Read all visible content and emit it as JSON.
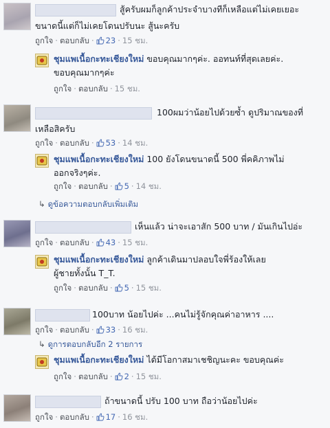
{
  "comments": [
    {
      "text_line1": "สู้ครับผมก็ลูกค้าประจำบางทีก็เหลือแต่ไม่เคยเยอะ",
      "text_line2": "ขนาดนี้แต่ก็ไม่เคยโดนปรับนะ สู้นะครับ",
      "like_label": "ถูกใจ",
      "reply_label": "ตอบกลับ",
      "likes": "23",
      "time": "15 ชม.",
      "reply": {
        "page_name": "ชุมแพเนื้อกะทะเชียงใหม่",
        "text_line1": "ขอบคุณมากๆค่ะ. ออทนท์ที่สุดเลยค่ะ.",
        "text_line2": "ขอบคุณมากๆค่ะ",
        "like_label": "ถูกใจ",
        "reply_label": "ตอบกลับ",
        "time": "15 ชม."
      }
    },
    {
      "text_line1": "100ผมว่าน้อยไปด้วยซ้ำ ดูปริมาณของที่",
      "text_line2": "เหลือสิครับ",
      "like_label": "ถูกใจ",
      "reply_label": "ตอบกลับ",
      "likes": "53",
      "time": "14 ชม.",
      "reply": {
        "page_name": "ชุมแพเนื้อกะทะเชียงใหม่",
        "text_line1": "100 ยังโดนขนาดนี้ 500 พี่คคิภาพไม่",
        "text_line2": "ออกจริงๆค่ะ.",
        "like_label": "ถูกใจ",
        "reply_label": "ตอบกลับ",
        "likes": "5",
        "time": "14 ชม."
      },
      "more_replies": "ดูข้อความตอบกลับเพิ่มเติม"
    },
    {
      "text_line1": "เห็นแล้ว น่าจะเอาสัก 500 บาท / มันเกินไปอ่ะ",
      "like_label": "ถูกใจ",
      "reply_label": "ตอบกลับ",
      "likes": "43",
      "time": "15 ชม.",
      "reply": {
        "page_name": "ชุมแพเนื้อกะทะเชียงใหม่",
        "text_line1": "ลูกค้าเดินมาปลอบใจพี่ร้องให้เลย",
        "text_line2": "ผู้ชายทั้งนั้น T_T.",
        "like_label": "ถูกใจ",
        "reply_label": "ตอบกลับ",
        "likes": "5",
        "time": "15 ชม."
      }
    },
    {
      "text_line1": "100บาท น้อยไปค่ะ ...คนไม่รู้จักคุณค่าอาหาร ....",
      "like_label": "ถูกใจ",
      "reply_label": "ตอบกลับ",
      "likes": "33",
      "time": "16 ชม.",
      "more_replies": "ดูการตอบกลับอีก 2 รายการ",
      "reply": {
        "page_name": "ชุมแพเนื้อกะทะเชียงใหม่",
        "text_line1": "ได้มีโอกาสมาเชชิญนะคะ ขอบคุณค่ะ",
        "like_label": "ถูกใจ",
        "reply_label": "ตอบกลับ",
        "likes": "2",
        "time": "15 ชม."
      }
    },
    {
      "text_line1": "ถ้าขนาดนี้ ปรับ 100 บาท ถือว่าน้อยไปค่ะ",
      "like_label": "ถูกใจ",
      "reply_label": "ตอบกลับ",
      "likes": "17",
      "time": "16 ชม."
    }
  ],
  "colors": {
    "link": "#365899",
    "meta": "#90949c",
    "like": "#4267b2",
    "background": "#f6f7f9"
  },
  "icons": {
    "like": "thumbs-up-icon",
    "reply_arrow": "reply-arrow-icon",
    "page_logo": "page-logo-icon"
  }
}
